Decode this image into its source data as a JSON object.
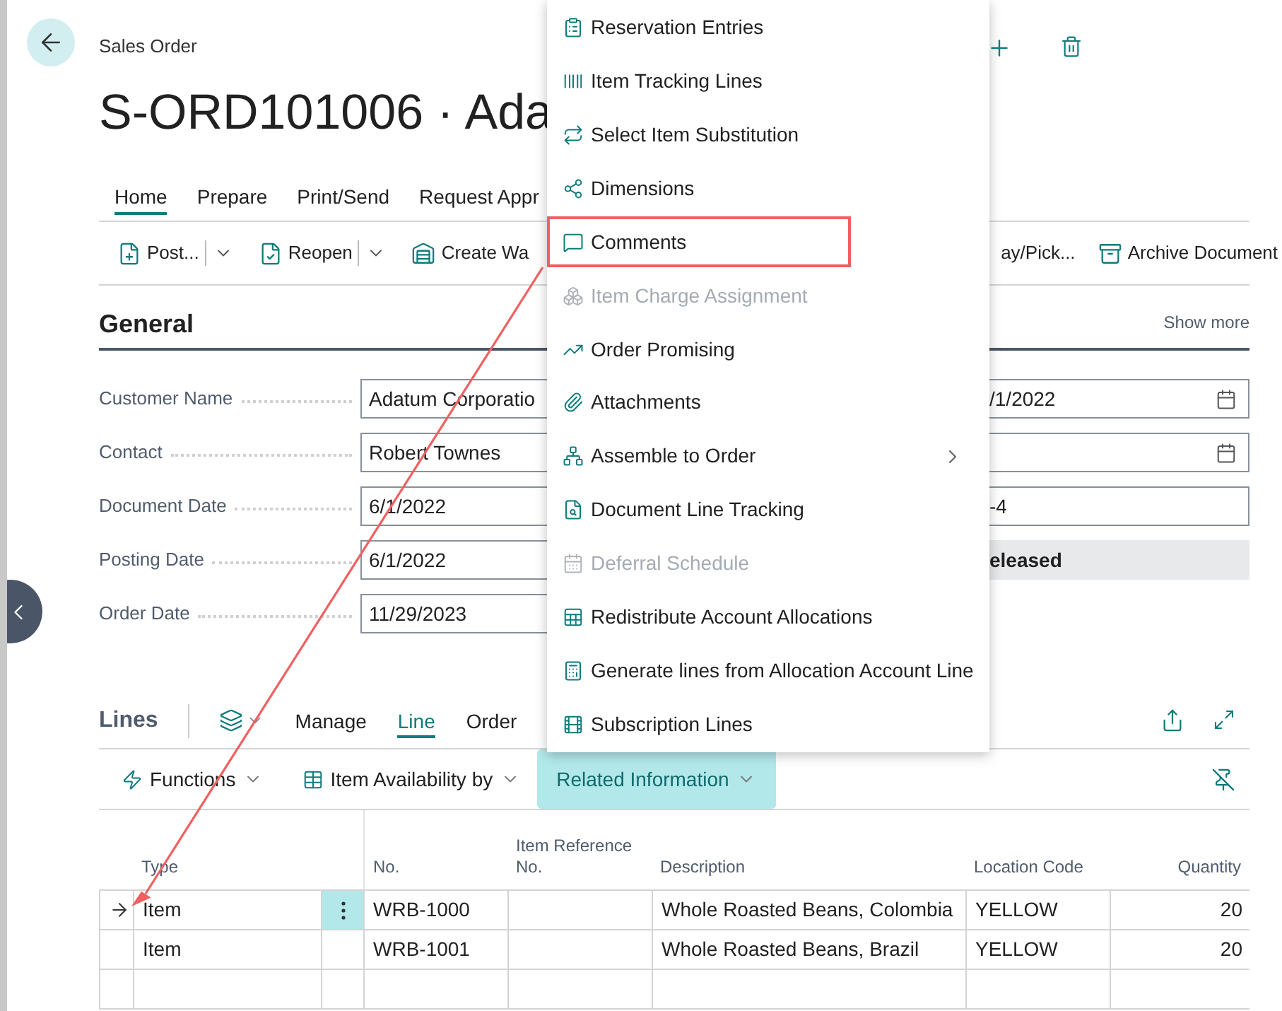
{
  "header": {
    "breadcrumb": "Sales Order",
    "title": "S-ORD101006 · Ada"
  },
  "tabs": [
    {
      "label": "Home",
      "selected": true
    },
    {
      "label": "Prepare",
      "selected": false
    },
    {
      "label": "Print/Send",
      "selected": false
    },
    {
      "label": "Request Appr",
      "selected": false
    }
  ],
  "actions": [
    {
      "label": "Post...",
      "kind": "split"
    },
    {
      "label": "Reopen",
      "kind": "split"
    },
    {
      "label": "Create Wa",
      "kind": "plain"
    },
    {
      "label": "ay/Pick...",
      "kind": "text"
    },
    {
      "label": "Archive Document",
      "kind": "plain"
    }
  ],
  "general": {
    "title": "General",
    "show_more": "Show more",
    "left_fields": [
      {
        "label": "Customer Name",
        "value": "Adatum Corporatio"
      },
      {
        "label": "Contact",
        "value": "Robert Townes"
      },
      {
        "label": "Document Date",
        "value": "6/1/2022"
      },
      {
        "label": "Posting Date",
        "value": "6/1/2022"
      },
      {
        "label": "Order Date",
        "value": "11/29/2023"
      }
    ],
    "right_fields": [
      {
        "kind": "date",
        "value": "/1/2022"
      },
      {
        "kind": "date"
      },
      {
        "kind": "text",
        "value": "-4"
      },
      {
        "kind": "status",
        "value": "eleased"
      }
    ]
  },
  "lines": {
    "title": "Lines",
    "tabs": [
      {
        "label": "Manage",
        "selected": false
      },
      {
        "label": "Line",
        "selected": true
      },
      {
        "label": "Order",
        "selected": false
      }
    ],
    "actions": [
      {
        "label": "Functions",
        "selected": false
      },
      {
        "label": "Item Availability by",
        "selected": false
      },
      {
        "label": "Related Information",
        "selected": true
      }
    ],
    "table": {
      "columns": [
        "Type",
        "No.",
        "Item Reference No.",
        "Description",
        "Location Code",
        "Quantity"
      ],
      "rows": [
        {
          "type": "Item",
          "no": "WRB-1000",
          "description": "Whole Roasted Beans, Colombia",
          "location_code": "YELLOW",
          "quantity": "20",
          "selected": true
        },
        {
          "type": "Item",
          "no": "WRB-1001",
          "description": "Whole Roasted Beans, Brazil",
          "location_code": "YELLOW",
          "quantity": "20",
          "selected": false
        }
      ]
    }
  },
  "menu": {
    "items": [
      {
        "label": "Reservation Entries",
        "disabled": false,
        "submenu": false,
        "marked": false
      },
      {
        "label": "Item Tracking Lines",
        "disabled": false,
        "submenu": false,
        "marked": false
      },
      {
        "label": "Select Item Substitution",
        "disabled": false,
        "submenu": false,
        "marked": false
      },
      {
        "label": "Dimensions",
        "disabled": false,
        "submenu": false,
        "marked": false
      },
      {
        "label": "Comments",
        "disabled": false,
        "submenu": false,
        "marked": true
      },
      {
        "label": "Item Charge Assignment",
        "disabled": true,
        "submenu": false,
        "marked": false
      },
      {
        "label": "Order Promising",
        "disabled": false,
        "submenu": false,
        "marked": false
      },
      {
        "label": "Attachments",
        "disabled": false,
        "submenu": false,
        "marked": false
      },
      {
        "label": "Assemble to Order",
        "disabled": false,
        "submenu": true,
        "marked": false
      },
      {
        "label": "Document Line Tracking",
        "disabled": false,
        "submenu": false,
        "marked": false
      },
      {
        "label": "Deferral Schedule",
        "disabled": true,
        "submenu": false,
        "marked": false
      },
      {
        "label": "Redistribute Account Allocations",
        "disabled": false,
        "submenu": false,
        "marked": false
      },
      {
        "label": "Generate lines from Allocation Account Line",
        "disabled": false,
        "submenu": false,
        "marked": false
      },
      {
        "label": "Subscription Lines",
        "disabled": false,
        "submenu": false,
        "marked": false
      }
    ]
  }
}
